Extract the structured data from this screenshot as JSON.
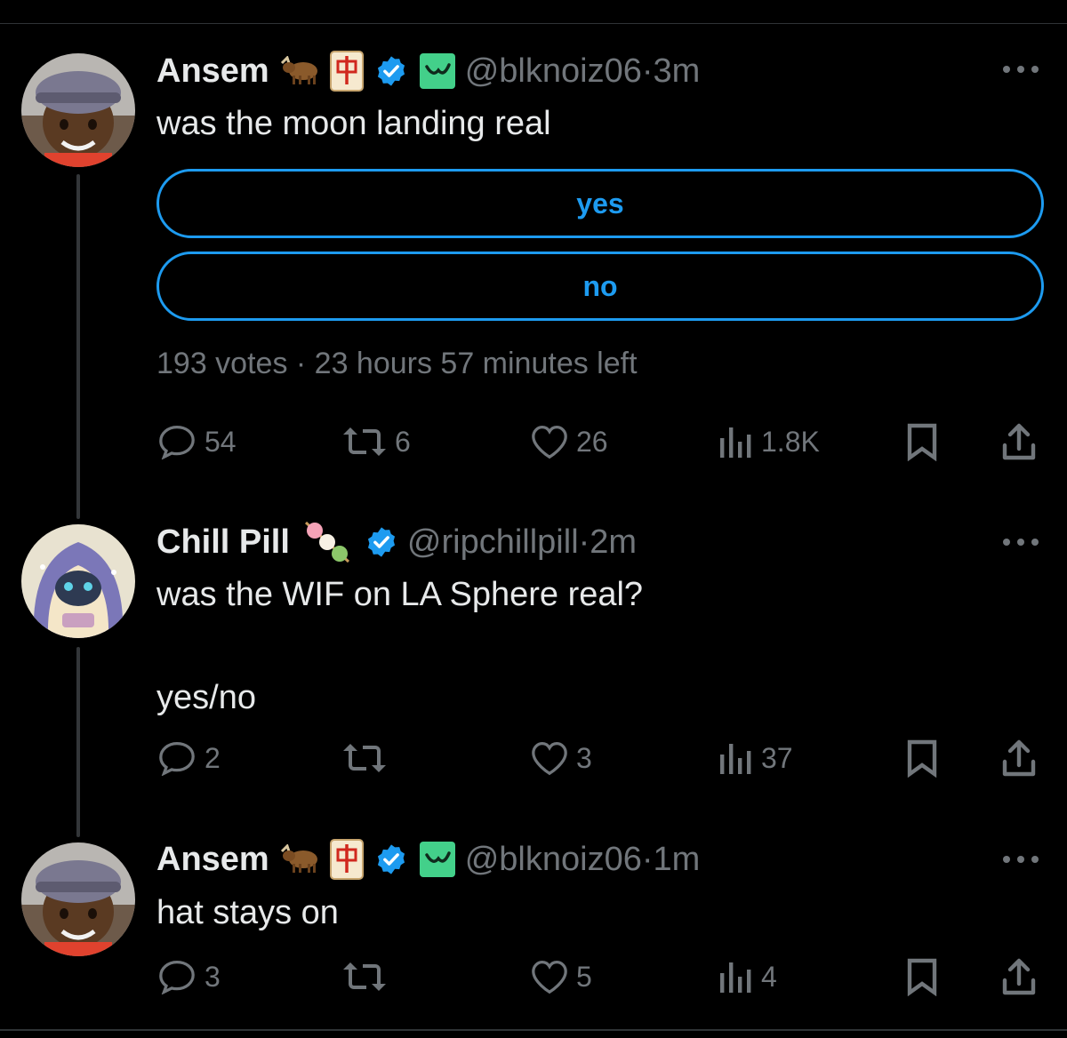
{
  "posts": [
    {
      "name": "Ansem",
      "handle": "@blknoiz06",
      "time": "3m",
      "text": "was the moon landing real",
      "poll": {
        "options": [
          "yes",
          "no"
        ],
        "meta": "193 votes · 23 hours 57 minutes left"
      },
      "replies": "54",
      "reposts": "6",
      "likes": "26",
      "views": "1.8K"
    },
    {
      "name": "Chill Pill",
      "handle": "@ripchillpill",
      "time": "2m",
      "text": "was the WIF on LA Sphere real?",
      "text2": "yes/no",
      "replies": "2",
      "reposts": "",
      "likes": "3",
      "views": "37"
    },
    {
      "name": "Ansem",
      "handle": "@blknoiz06",
      "time": "1m",
      "text": "hat stays on",
      "replies": "3",
      "reposts": "",
      "likes": "5",
      "views": "4"
    }
  ],
  "separator": " · ",
  "colors": {
    "accent": "#1d9bf0",
    "muted": "#71767b",
    "text": "#e7e9ea",
    "background": "#000000"
  },
  "icons": [
    "ox-emoji",
    "mahjong-red-dragon-emoji",
    "verified-badge-icon",
    "green-app-badge-icon",
    "dango-emoji",
    "more-icon",
    "reply-icon",
    "repost-icon",
    "like-icon",
    "views-icon",
    "bookmark-icon",
    "share-icon"
  ]
}
